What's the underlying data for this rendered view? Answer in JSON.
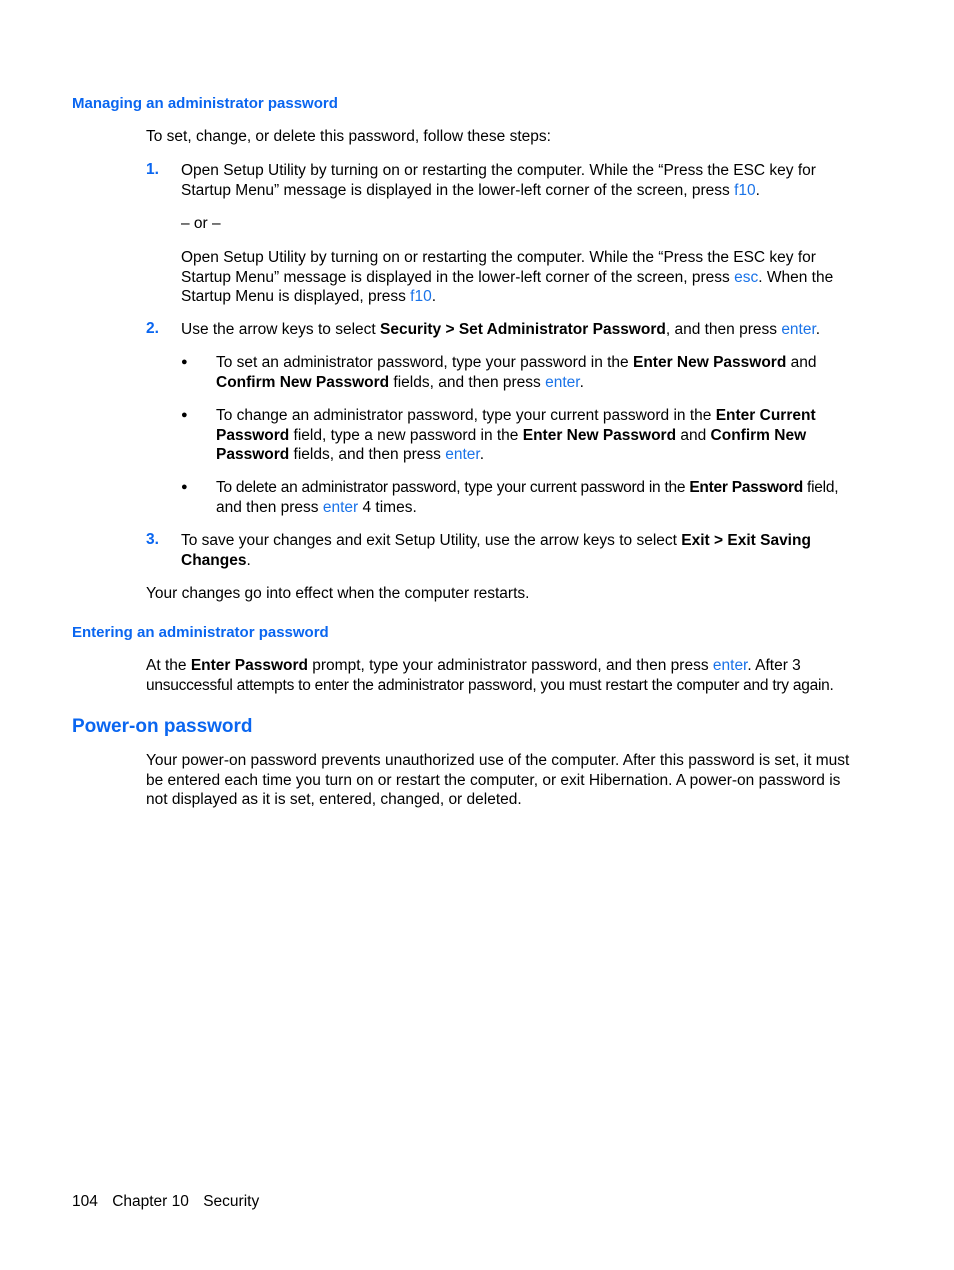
{
  "section1": {
    "heading": "Managing an administrator password",
    "intro": "To set, change, or delete this password, follow these steps:",
    "step1": {
      "num": "1.",
      "a1": "Open Setup Utility by turning on or restarting the computer. While the “Press the ESC key for",
      "a2": "Startup Menu” message is displayed in the lower-left corner of the screen, press ",
      "a2_key": "f10",
      "or": "– or –",
      "b1": "Open Setup Utility by turning on or restarting the computer. While the “Press the ESC key for",
      "b2": "Startup Menu” message is displayed in the lower-left corner of the screen, press ",
      "b2_key": "esc",
      "b2_tail": ". When the",
      "b3": "Startup Menu is displayed, press ",
      "b3_key": "f10"
    },
    "step2": {
      "num": "2.",
      "pre": "Use the arrow keys to select ",
      "bold": "Security > Set Administrator Password",
      "mid": ", and then press ",
      "key": "enter",
      "bullets": [
        {
          "l1_pre": "To set an administrator password, type your password in the ",
          "l1_bold": "Enter New Password",
          "l1_post": " and",
          "l2_bold": "Confirm New Password",
          "l2_post": " fields, and then press ",
          "key": "enter"
        },
        {
          "l1_pre": "To change an administrator password, type your current password in the ",
          "l1_bold": "Enter Current",
          "l2_bold": "Password",
          "l2_mid": " field, type a new password in the ",
          "l2_bold2": "Enter New Password",
          "l2_and": " and ",
          "l2_bold3": "Confirm New",
          "l3_bold": "Password",
          "l3_post": " fields, and then press ",
          "key": "enter"
        },
        {
          "l1_pre": "To delete an administrator password, type your current password in the ",
          "l1_bold": "Enter Password",
          "l1_post": " field,",
          "l2_pre": "and then press ",
          "key": "enter",
          "l2_post": " 4 times."
        }
      ]
    },
    "step3": {
      "num": "3.",
      "pre": "To save your changes and exit Setup Utility, use the arrow keys to select ",
      "bold1": "Exit > Exit Saving",
      "bold2": "Changes"
    },
    "outro": "Your changes go into effect when the computer restarts."
  },
  "section2": {
    "heading": "Entering an administrator password",
    "l1_pre": "At the ",
    "l1_bold": "Enter Password",
    "l1_mid": " prompt, type your administrator password, and then press ",
    "key": "enter",
    "l1_post": ". After 3",
    "l2": "unsuccessful attempts to enter the administrator password, you must restart the computer and try again."
  },
  "section3": {
    "heading": "Power-on password",
    "l1": "Your power-on password prevents unauthorized use of the computer. After this password is set, it must",
    "l2": "be entered each time you turn on or restart the computer, or exit Hibernation. A power-on password is",
    "l3": "not displayed as it is set, entered, changed, or deleted."
  },
  "footer": {
    "page": "104",
    "chapter": "Chapter 10",
    "title": "Security"
  }
}
